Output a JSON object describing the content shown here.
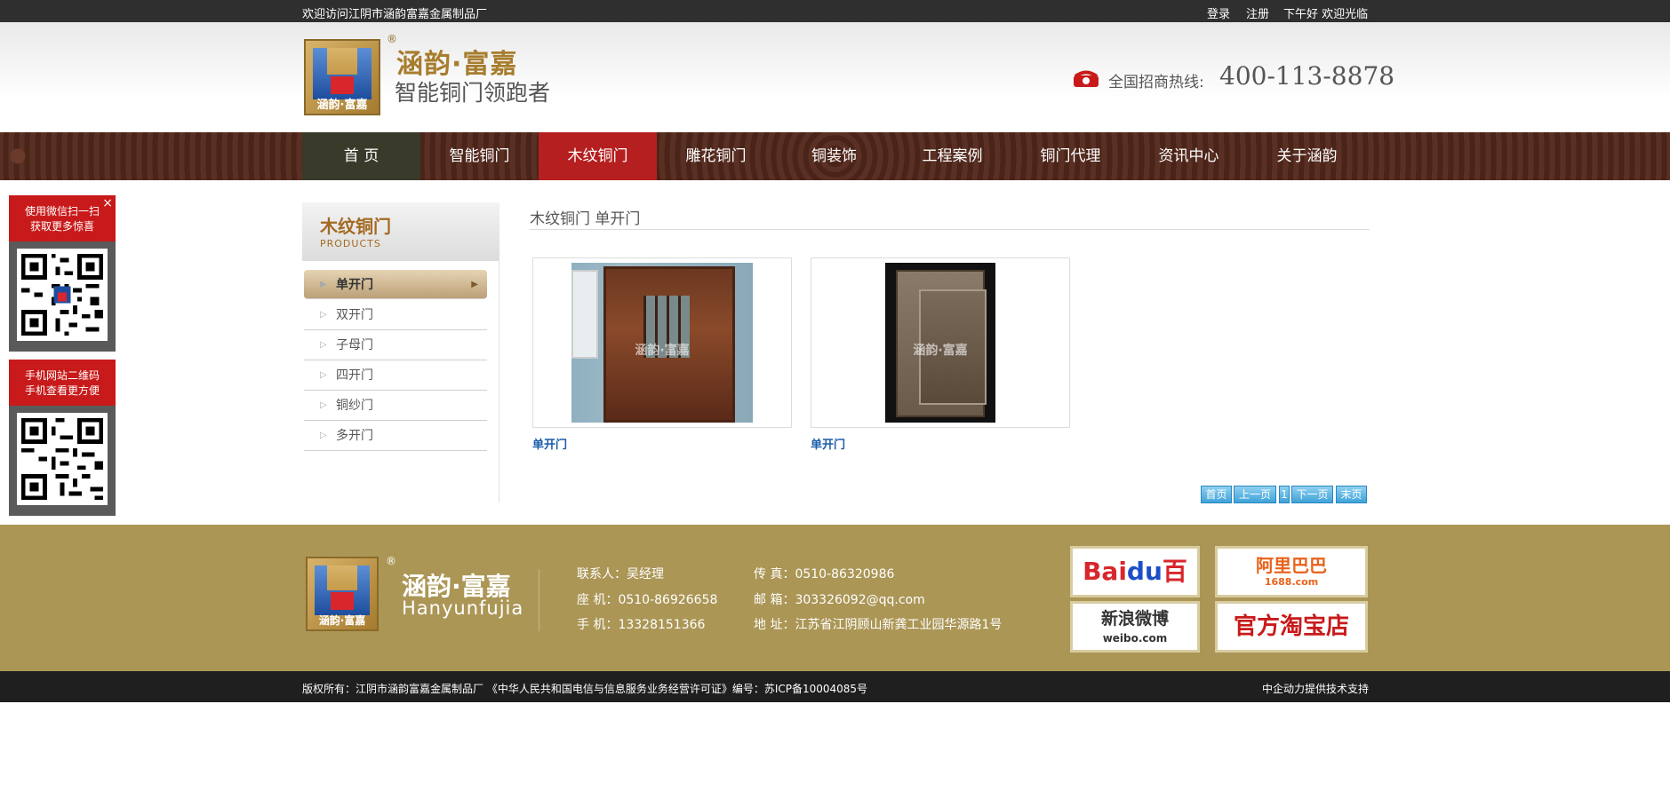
{
  "topbar": {
    "welcome": "欢迎访问江阴市涵韵富嘉金属制品厂",
    "login": "登录",
    "register": "注册",
    "greeting": "下午好 欢迎光临"
  },
  "header": {
    "logo_text": "涵韵·富嘉",
    "registered_mark": "®",
    "brand_name": "涵韵·富嘉",
    "slogan": "智能铜门领跑者",
    "hotline_label": "全国招商热线:",
    "hotline_number": "400-113-8878"
  },
  "nav": {
    "items": [
      {
        "label": "首 页"
      },
      {
        "label": "智能铜门"
      },
      {
        "label": "木纹铜门"
      },
      {
        "label": "雕花铜门"
      },
      {
        "label": "铜装饰"
      },
      {
        "label": "工程案例"
      },
      {
        "label": "铜门代理"
      },
      {
        "label": "资讯中心"
      },
      {
        "label": "关于涵韵"
      }
    ],
    "active_index": 2
  },
  "float_qr": {
    "wechat_line1": "使用微信扫一扫",
    "wechat_line2": "获取更多惊喜",
    "close": "×",
    "mobile_line1": "手机网站二维码",
    "mobile_line2": "手机查看更方便"
  },
  "sidebar": {
    "title": "木纹铜门",
    "subtitle": "PRODUCTS",
    "items": [
      {
        "label": "单开门"
      },
      {
        "label": "双开门"
      },
      {
        "label": "子母门"
      },
      {
        "label": "四开门"
      },
      {
        "label": "铜纱门"
      },
      {
        "label": "多开门"
      }
    ],
    "active_index": 0
  },
  "content": {
    "breadcrumb": "木纹铜门  单开门",
    "watermark": "涵韵·富嘉",
    "products": [
      {
        "name": "单开门"
      },
      {
        "name": "单开门"
      }
    ]
  },
  "pager": {
    "first": "首页",
    "prev": "上一页",
    "current": "1",
    "next": "下一页",
    "last": "末页"
  },
  "footer": {
    "logo_text": "涵韵·富嘉",
    "registered_mark": "®",
    "brand": "涵韵·富嘉",
    "brand_en": "Hanyunfujia",
    "contact": "联系人：吴经理",
    "landline": "座 机：0510-86926658",
    "mobile": "手 机：13328151366",
    "fax": "传 真：0510-86320986",
    "email": "邮 箱：303326092@qq.com",
    "address": "地 址：江苏省江阴顾山新龚工业园华源路1号",
    "links": {
      "baidu_a": "Bai",
      "baidu_b": "du",
      "baidu_c": "百度",
      "alibaba": "阿里巴巴",
      "alibaba_sub": "1688.com",
      "weibo": "新浪微博",
      "weibo_sub": "weibo.com",
      "taobao": "官方淘宝店"
    }
  },
  "bottombar": {
    "copyright": "版权所有：江阴市涵韵富嘉金属制品厂 《中华人民共和国电信与信息服务业务经营许可证》编号：苏ICP备10004085号",
    "tech": "中企动力提供技术支持"
  },
  "colors": {
    "nav_active": "#b51f1f",
    "footer_bg": "#ab9656",
    "brand_gold": "#a77d2e",
    "link_blue": "#1a5ca8"
  }
}
